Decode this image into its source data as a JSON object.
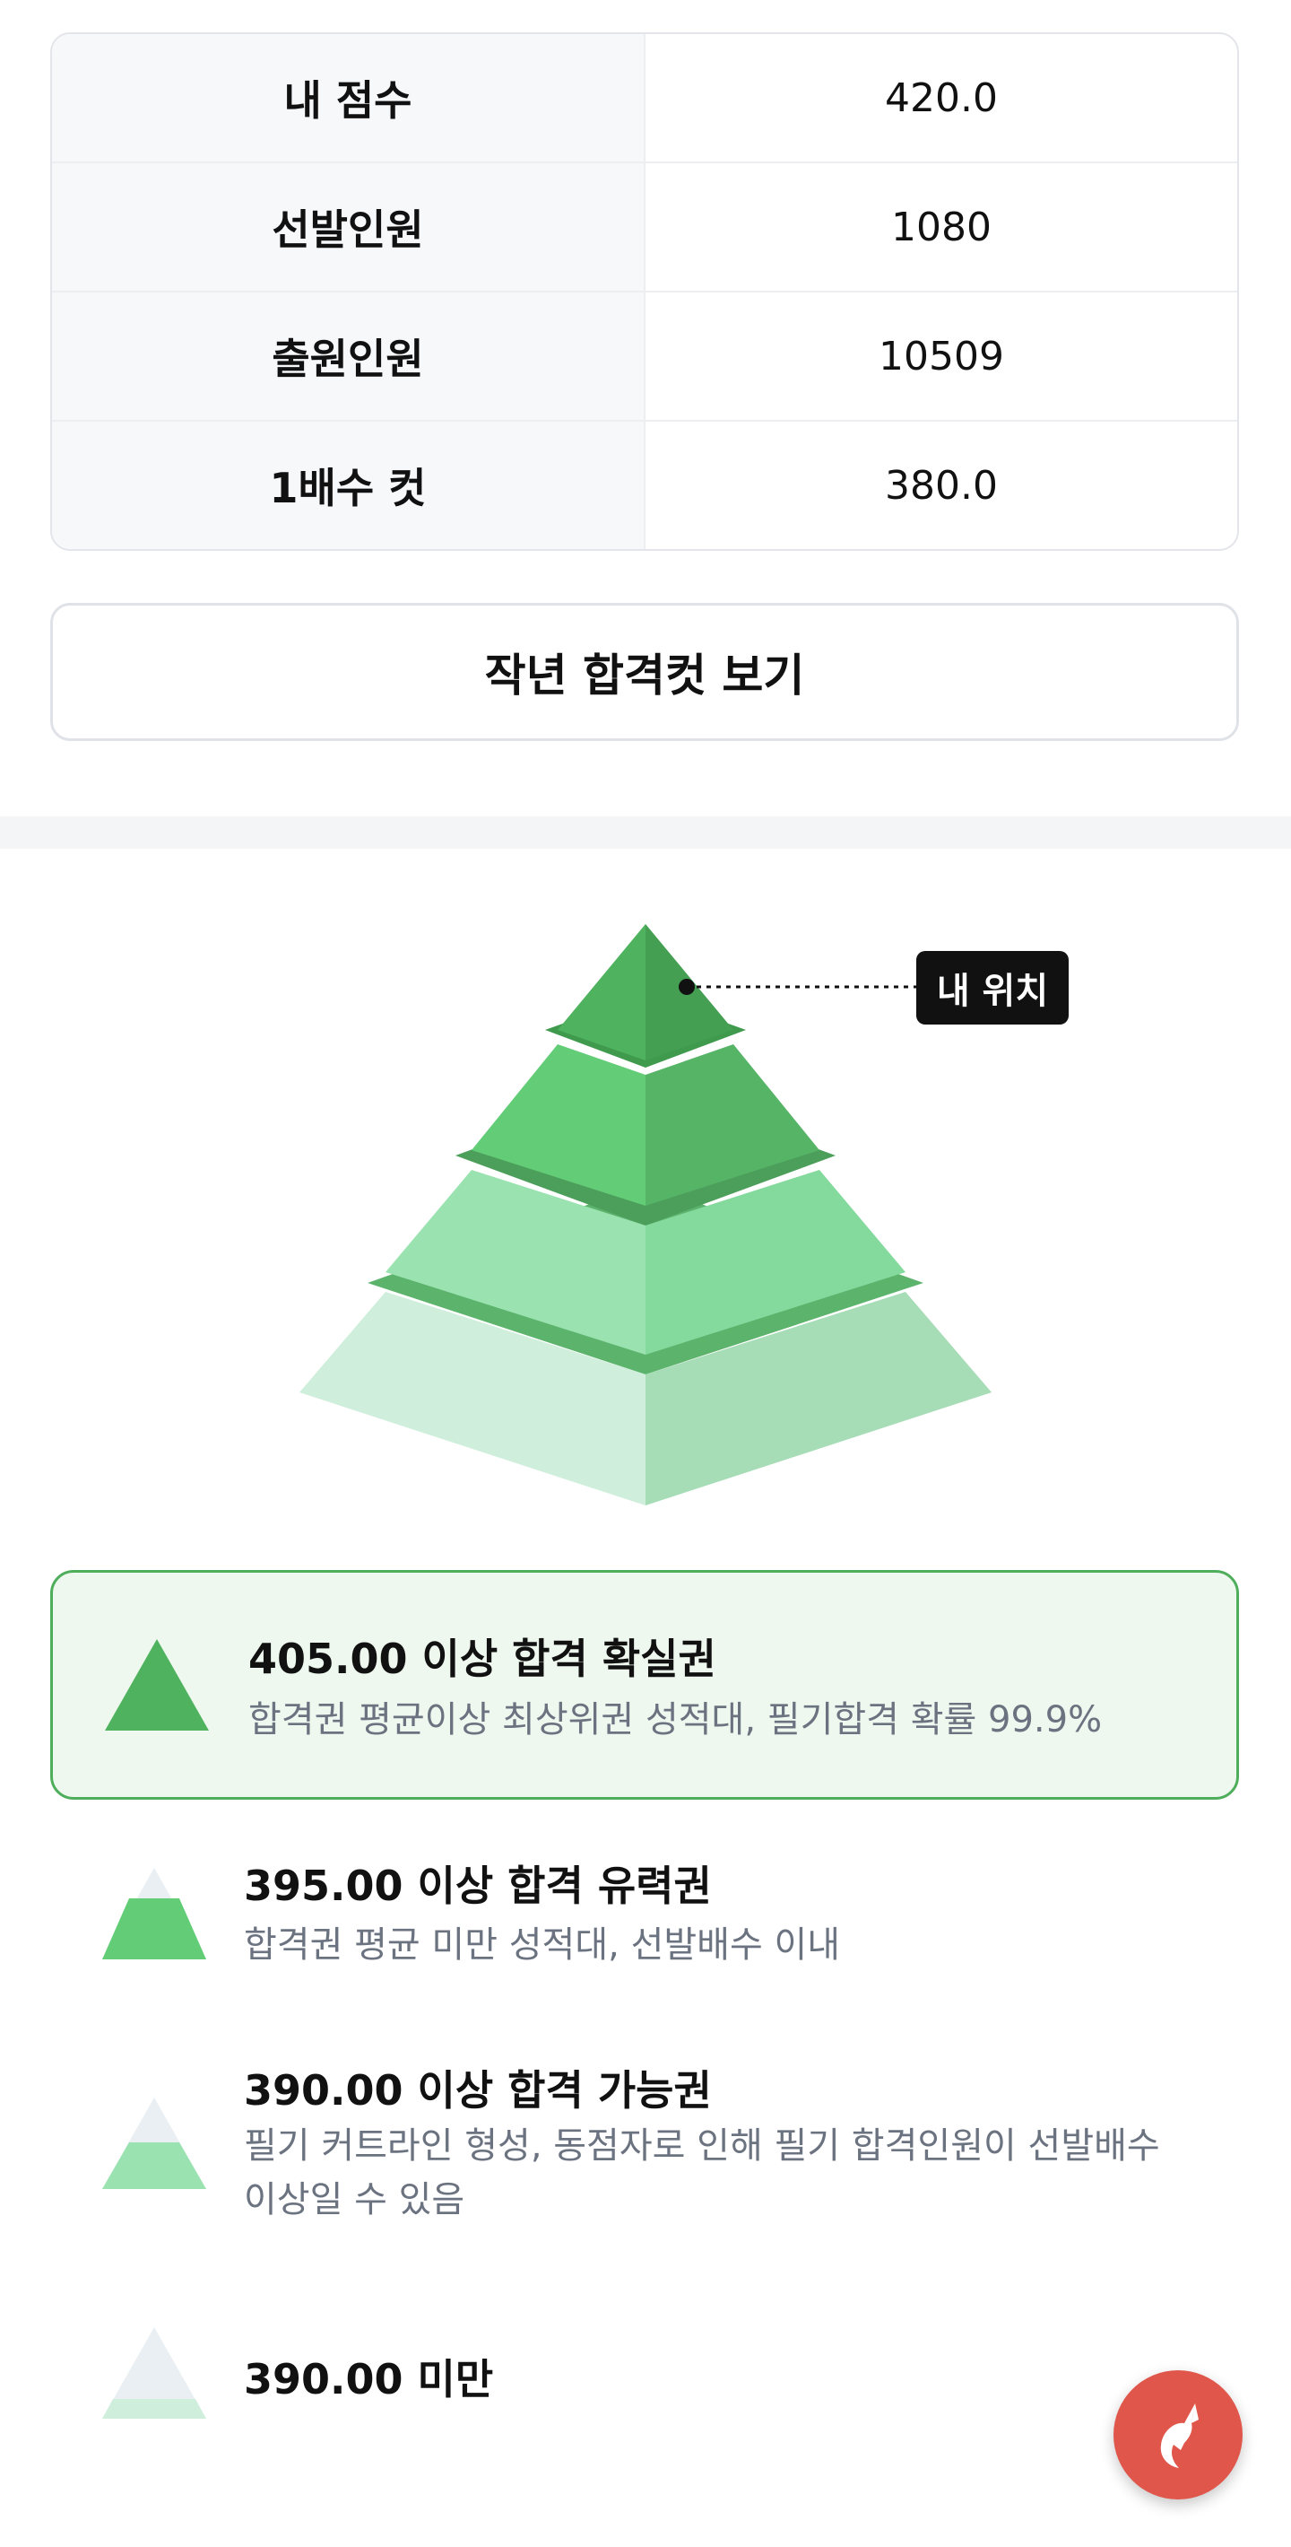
{
  "info_table": {
    "rows": [
      {
        "label": "내 점수",
        "value": "420.0"
      },
      {
        "label": "선발인원",
        "value": "1080"
      },
      {
        "label": "출원인원",
        "value": "10509"
      },
      {
        "label": "1배수 컷",
        "value": "380.0"
      }
    ]
  },
  "cut_button": {
    "label": "작년 합격컷 보기"
  },
  "pyramid": {
    "marker_label": "내 위치",
    "marker_tier": 1,
    "colors": {
      "tier1_left": "#4fb25e",
      "tier1_right": "#449f52",
      "tier1_band": "#3f9a4e",
      "tier2_left": "#62cc76",
      "tier2_right": "#56b466",
      "tier2_band": "#4c9e5b",
      "tier3_left": "#9ae3b1",
      "tier3_right": "#84d99d",
      "tier3_band": "#5cb36c",
      "tier4_left": "#cfeedb",
      "tier4_right": "#a6dcb6"
    }
  },
  "legend": [
    {
      "title": "405.00 이상 합격 확실권",
      "desc": "합격권 평균이상 최상위권 성적대, 필기합격 확률 99.9%",
      "active": true,
      "icon": "pyramid-top-tier-icon"
    },
    {
      "title": "395.00 이상 합격 유력권",
      "desc": "합격권 평균 미만 성적대, 선발배수 이내",
      "active": false,
      "icon": "pyramid-second-tier-icon"
    },
    {
      "title": "390.00 이상 합격 가능권",
      "desc": "필기 커트라인 형성, 동점자로 인해 필기 합격인원이 선발배수 이상일 수 있음",
      "active": false,
      "icon": "pyramid-third-tier-icon"
    },
    {
      "title": "390.00 미만",
      "desc": "",
      "active": false,
      "icon": "pyramid-bottom-tier-icon"
    }
  ],
  "fab": {
    "icon": "unicorn-logo-icon",
    "color": "#e0564a"
  }
}
